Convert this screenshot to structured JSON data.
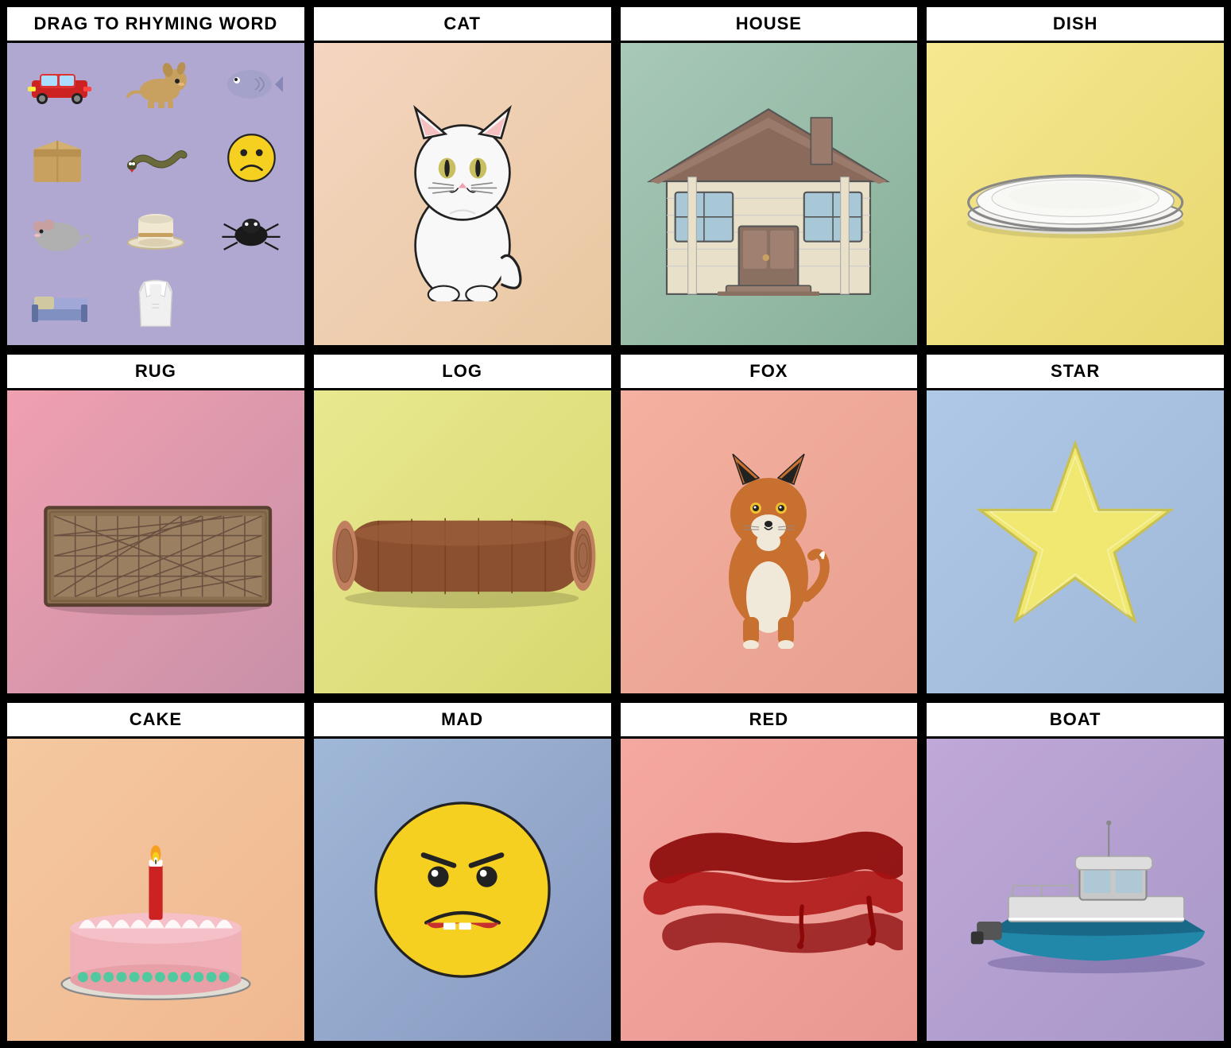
{
  "grid": {
    "cells": [
      {
        "id": "drag-source",
        "header": "DRAG TO RHYMING WORD",
        "type": "drag-source"
      },
      {
        "id": "cat",
        "header": "CAT",
        "bg": "bg-peach-cat",
        "type": "cat"
      },
      {
        "id": "house",
        "header": "HOUSE",
        "bg": "bg-teal",
        "type": "house"
      },
      {
        "id": "dish",
        "header": "DISH",
        "bg": "bg-yellow",
        "type": "dish"
      },
      {
        "id": "rug",
        "header": "RUG",
        "bg": "bg-pink-rug",
        "type": "rug"
      },
      {
        "id": "log",
        "header": "LOG",
        "bg": "bg-yellow-log",
        "type": "log"
      },
      {
        "id": "fox",
        "header": "FOX",
        "bg": "bg-pink-fox",
        "type": "fox"
      },
      {
        "id": "star",
        "header": "STAR",
        "bg": "bg-blue-star",
        "type": "star"
      },
      {
        "id": "cake",
        "header": "CAKE",
        "bg": "bg-pink-cake",
        "type": "cake"
      },
      {
        "id": "mad",
        "header": "MAD",
        "bg": "bg-blue-mad",
        "type": "mad"
      },
      {
        "id": "red",
        "header": "RED",
        "bg": "bg-pink-red",
        "type": "red"
      },
      {
        "id": "boat",
        "header": "BOAT",
        "bg": "bg-purple-boat",
        "type": "boat"
      }
    ]
  }
}
